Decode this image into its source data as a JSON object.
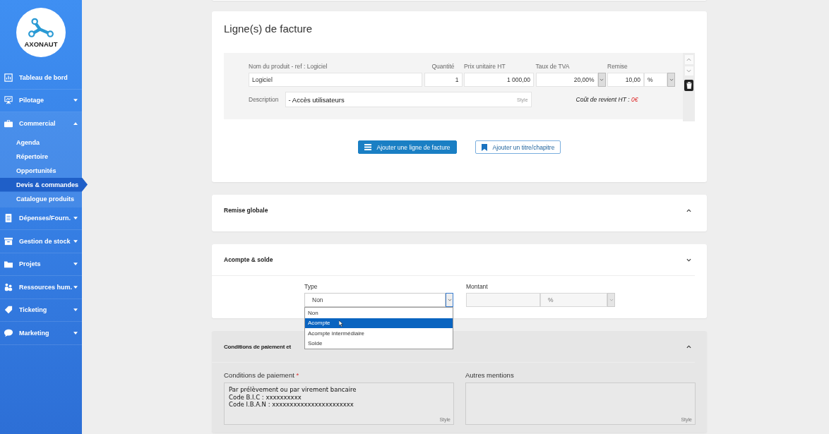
{
  "sidebar": {
    "logo_text": "AXONAUT",
    "items": [
      {
        "label": "Tableau de bord",
        "kind": "link"
      },
      {
        "label": "Pilotage",
        "kind": "menu",
        "expanded": false
      },
      {
        "label": "Commercial",
        "kind": "menu",
        "expanded": true,
        "children": [
          {
            "label": "Agenda",
            "selected": false
          },
          {
            "label": "Répertoire",
            "selected": false
          },
          {
            "label": "Opportunités",
            "selected": false
          },
          {
            "label": "Devis & commandes",
            "selected": true
          },
          {
            "label": "Catalogue produits",
            "selected": false
          }
        ]
      },
      {
        "label": "Dépenses/Fourn.",
        "kind": "menu",
        "expanded": false
      },
      {
        "label": "Gestion de stock",
        "kind": "menu",
        "expanded": false
      },
      {
        "label": "Projets",
        "kind": "menu",
        "expanded": false
      },
      {
        "label": "Ressources hum.",
        "kind": "menu",
        "expanded": false
      },
      {
        "label": "Ticketing",
        "kind": "menu",
        "expanded": false
      },
      {
        "label": "Marketing",
        "kind": "menu",
        "expanded": false
      }
    ]
  },
  "invoice_lines": {
    "title": "Ligne(s) de facture",
    "line": {
      "product_label": "Nom du produit - ref : Logiciel",
      "product": "Logiciel",
      "quantity_label": "Quantité",
      "quantity": "1",
      "price_label": "Prix unitaire HT",
      "price": "1 000,00",
      "vat_label": "Taux de TVA",
      "vat": "20,00%",
      "discount_label": "Remise",
      "discount": "10,00",
      "discount_unit": "%",
      "description_label": "Description",
      "description": "- Accès utilisateurs",
      "style_hint": "Style",
      "cost_label": "Coût de revient HT : ",
      "cost": "0€"
    },
    "buttons": [
      {
        "label": "Ajouter une ligne de facture",
        "kind": "primary"
      },
      {
        "label": "Ajouter un titre/chapitre",
        "kind": "outline"
      }
    ]
  },
  "global_discount": {
    "title": "Remise globale",
    "expanded": true
  },
  "deposit": {
    "title": "Acompte & solde",
    "expanded": false,
    "type_label": "Type",
    "type_value": "Non",
    "amount_label": "Montant",
    "amount_unit": "%",
    "options": [
      {
        "label": "Non",
        "selected": false
      },
      {
        "label": "Acompte",
        "selected": true
      },
      {
        "label": "Acompte intermédiaire",
        "selected": false
      },
      {
        "label": "Solde",
        "selected": false
      }
    ]
  },
  "payment": {
    "title": "Conditions de paiement et",
    "expanded": true,
    "conditions_label": "Conditions de paiement",
    "required_mark": "*",
    "conditions_lines": [
      "Par prélèvement ou par virement bancaire",
      "Code B.I.C : xxxxxxxxxx",
      "Code I.B.A.N : xxxxxxxxxxxxxxxxxxxxxxx"
    ],
    "conditions_hint": "Style",
    "other_label": "Autres mentions",
    "other_hint": "Style"
  }
}
